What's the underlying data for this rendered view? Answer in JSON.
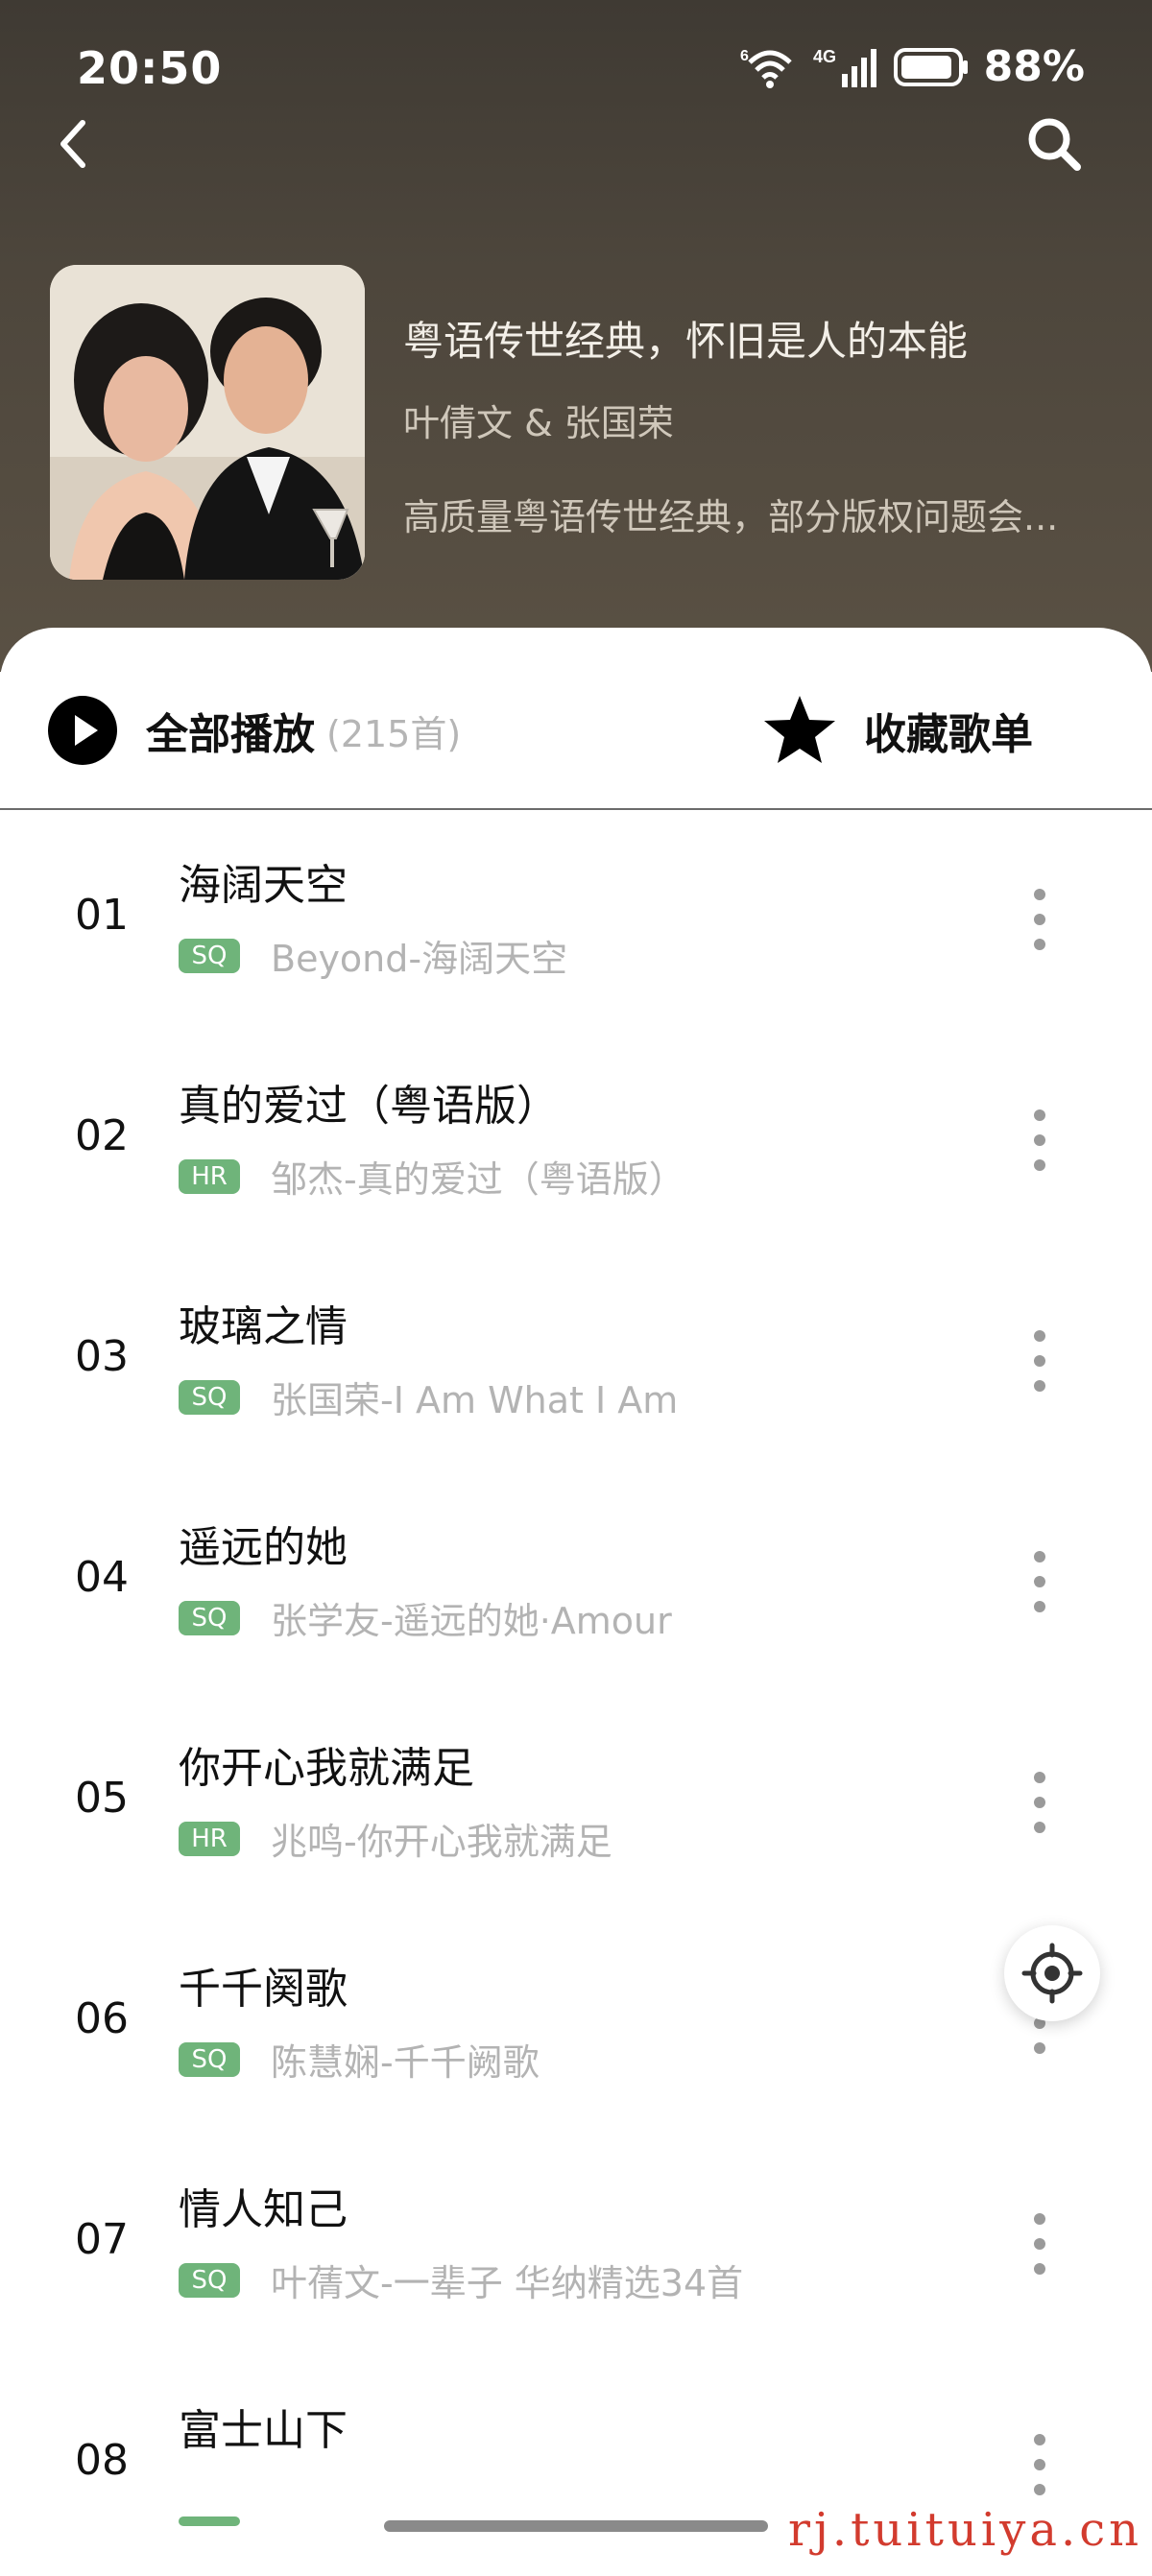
{
  "status_bar": {
    "time": "20:50",
    "network": "4G",
    "wifi_badge": "6",
    "battery": "88%"
  },
  "album": {
    "title": "粤语传世经典，怀旧是人的本能",
    "artist": "叶倩文 & 张国荣",
    "description": "高质量粤语传世经典，部分版权问题会..."
  },
  "actions": {
    "play_all_label": "全部播放",
    "play_all_count": "(215首)",
    "favorite_label": "收藏歌单"
  },
  "tracks": [
    {
      "num": "01",
      "title": "海阔天空",
      "quality": "SQ",
      "artist_album": "Beyond-海阔天空"
    },
    {
      "num": "02",
      "title": "真的爱过（粤语版）",
      "quality": "HR",
      "artist_album": "邹杰-真的爱过（粤语版）"
    },
    {
      "num": "03",
      "title": "玻璃之情",
      "quality": "SQ",
      "artist_album": "张国荣-I Am What I Am"
    },
    {
      "num": "04",
      "title": "遥远的她",
      "quality": "SQ",
      "artist_album": "张学友-遥远的她·Amour"
    },
    {
      "num": "05",
      "title": "你开心我就满足",
      "quality": "HR",
      "artist_album": "兆鸣-你开心我就满足"
    },
    {
      "num": "06",
      "title": "千千阕歌",
      "quality": "SQ",
      "artist_album": "陈慧娴-千千阙歌"
    },
    {
      "num": "07",
      "title": "情人知己",
      "quality": "SQ",
      "artist_album": "叶蒨文-一辈子 华纳精选34首"
    },
    {
      "num": "08",
      "title": "富士山下",
      "quality": "SQ",
      "artist_album": ""
    }
  ],
  "watermark": "rj.tuituiya.cn",
  "colors": {
    "hero_bg": "#4d463c",
    "badge_green": "#6fb47a",
    "secondary_text": "#b3b3b3"
  },
  "icons": {
    "back": "chevron-left-icon",
    "search": "search-icon",
    "play": "play-circle-icon",
    "favorite": "star-icon",
    "more": "more-vertical-icon",
    "locate": "crosshair-icon"
  }
}
